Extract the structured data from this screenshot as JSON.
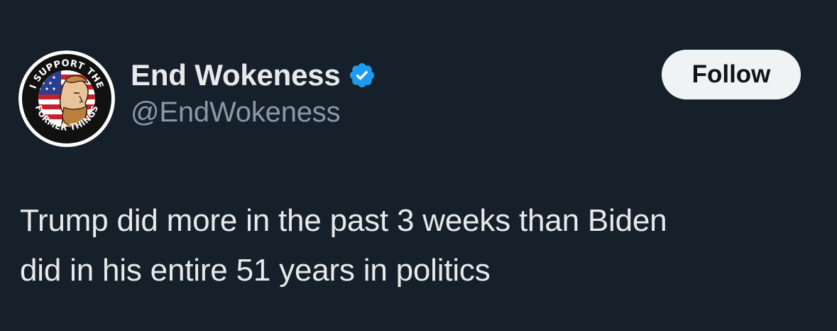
{
  "author": {
    "display_name": "End Wokeness",
    "handle": "@EndWokeness",
    "verified": true,
    "avatar": {
      "icon": "support-former-things-logo-icon",
      "text_top": "I SUPPORT THE",
      "text_bottom": "FORMER THINGS"
    }
  },
  "actions": {
    "follow_label": "Follow"
  },
  "tweet": {
    "text": "Trump did more in the past 3 weeks than Biden did in his entire 51 years in politics"
  },
  "colors": {
    "background": "#16202b",
    "primary_text": "#e7e9ea",
    "secondary_text": "#8b98a5",
    "verified_blue": "#1d9bf0",
    "follow_bg": "#eff3f4",
    "follow_text": "#0f1419"
  }
}
